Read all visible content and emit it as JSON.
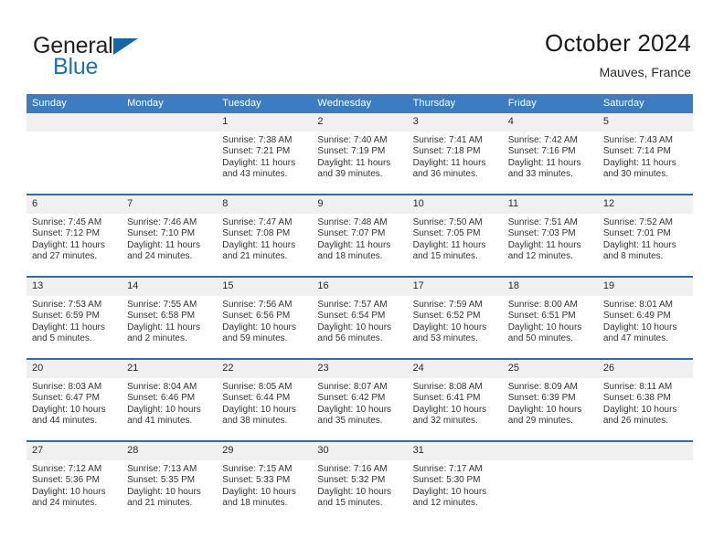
{
  "brand": {
    "name_part1": "General",
    "name_part2": "Blue",
    "accent_color": "#1565a8"
  },
  "header": {
    "title": "October 2024",
    "location": "Mauves, France"
  },
  "calendar": {
    "header_bg": "#3b7dc0",
    "separator_color": "#2e6da8",
    "daynum_bg": "#f0f0f0",
    "weekday_headers": [
      "Sunday",
      "Monday",
      "Tuesday",
      "Wednesday",
      "Thursday",
      "Friday",
      "Saturday"
    ],
    "weeks": [
      [
        {
          "day": "",
          "sunrise": "",
          "sunset": "",
          "daylight": ""
        },
        {
          "day": "",
          "sunrise": "",
          "sunset": "",
          "daylight": ""
        },
        {
          "day": "1",
          "sunrise": "Sunrise: 7:38 AM",
          "sunset": "Sunset: 7:21 PM",
          "daylight": "Daylight: 11 hours and 43 minutes."
        },
        {
          "day": "2",
          "sunrise": "Sunrise: 7:40 AM",
          "sunset": "Sunset: 7:19 PM",
          "daylight": "Daylight: 11 hours and 39 minutes."
        },
        {
          "day": "3",
          "sunrise": "Sunrise: 7:41 AM",
          "sunset": "Sunset: 7:18 PM",
          "daylight": "Daylight: 11 hours and 36 minutes."
        },
        {
          "day": "4",
          "sunrise": "Sunrise: 7:42 AM",
          "sunset": "Sunset: 7:16 PM",
          "daylight": "Daylight: 11 hours and 33 minutes."
        },
        {
          "day": "5",
          "sunrise": "Sunrise: 7:43 AM",
          "sunset": "Sunset: 7:14 PM",
          "daylight": "Daylight: 11 hours and 30 minutes."
        }
      ],
      [
        {
          "day": "6",
          "sunrise": "Sunrise: 7:45 AM",
          "sunset": "Sunset: 7:12 PM",
          "daylight": "Daylight: 11 hours and 27 minutes."
        },
        {
          "day": "7",
          "sunrise": "Sunrise: 7:46 AM",
          "sunset": "Sunset: 7:10 PM",
          "daylight": "Daylight: 11 hours and 24 minutes."
        },
        {
          "day": "8",
          "sunrise": "Sunrise: 7:47 AM",
          "sunset": "Sunset: 7:08 PM",
          "daylight": "Daylight: 11 hours and 21 minutes."
        },
        {
          "day": "9",
          "sunrise": "Sunrise: 7:48 AM",
          "sunset": "Sunset: 7:07 PM",
          "daylight": "Daylight: 11 hours and 18 minutes."
        },
        {
          "day": "10",
          "sunrise": "Sunrise: 7:50 AM",
          "sunset": "Sunset: 7:05 PM",
          "daylight": "Daylight: 11 hours and 15 minutes."
        },
        {
          "day": "11",
          "sunrise": "Sunrise: 7:51 AM",
          "sunset": "Sunset: 7:03 PM",
          "daylight": "Daylight: 11 hours and 12 minutes."
        },
        {
          "day": "12",
          "sunrise": "Sunrise: 7:52 AM",
          "sunset": "Sunset: 7:01 PM",
          "daylight": "Daylight: 11 hours and 8 minutes."
        }
      ],
      [
        {
          "day": "13",
          "sunrise": "Sunrise: 7:53 AM",
          "sunset": "Sunset: 6:59 PM",
          "daylight": "Daylight: 11 hours and 5 minutes."
        },
        {
          "day": "14",
          "sunrise": "Sunrise: 7:55 AM",
          "sunset": "Sunset: 6:58 PM",
          "daylight": "Daylight: 11 hours and 2 minutes."
        },
        {
          "day": "15",
          "sunrise": "Sunrise: 7:56 AM",
          "sunset": "Sunset: 6:56 PM",
          "daylight": "Daylight: 10 hours and 59 minutes."
        },
        {
          "day": "16",
          "sunrise": "Sunrise: 7:57 AM",
          "sunset": "Sunset: 6:54 PM",
          "daylight": "Daylight: 10 hours and 56 minutes."
        },
        {
          "day": "17",
          "sunrise": "Sunrise: 7:59 AM",
          "sunset": "Sunset: 6:52 PM",
          "daylight": "Daylight: 10 hours and 53 minutes."
        },
        {
          "day": "18",
          "sunrise": "Sunrise: 8:00 AM",
          "sunset": "Sunset: 6:51 PM",
          "daylight": "Daylight: 10 hours and 50 minutes."
        },
        {
          "day": "19",
          "sunrise": "Sunrise: 8:01 AM",
          "sunset": "Sunset: 6:49 PM",
          "daylight": "Daylight: 10 hours and 47 minutes."
        }
      ],
      [
        {
          "day": "20",
          "sunrise": "Sunrise: 8:03 AM",
          "sunset": "Sunset: 6:47 PM",
          "daylight": "Daylight: 10 hours and 44 minutes."
        },
        {
          "day": "21",
          "sunrise": "Sunrise: 8:04 AM",
          "sunset": "Sunset: 6:46 PM",
          "daylight": "Daylight: 10 hours and 41 minutes."
        },
        {
          "day": "22",
          "sunrise": "Sunrise: 8:05 AM",
          "sunset": "Sunset: 6:44 PM",
          "daylight": "Daylight: 10 hours and 38 minutes."
        },
        {
          "day": "23",
          "sunrise": "Sunrise: 8:07 AM",
          "sunset": "Sunset: 6:42 PM",
          "daylight": "Daylight: 10 hours and 35 minutes."
        },
        {
          "day": "24",
          "sunrise": "Sunrise: 8:08 AM",
          "sunset": "Sunset: 6:41 PM",
          "daylight": "Daylight: 10 hours and 32 minutes."
        },
        {
          "day": "25",
          "sunrise": "Sunrise: 8:09 AM",
          "sunset": "Sunset: 6:39 PM",
          "daylight": "Daylight: 10 hours and 29 minutes."
        },
        {
          "day": "26",
          "sunrise": "Sunrise: 8:11 AM",
          "sunset": "Sunset: 6:38 PM",
          "daylight": "Daylight: 10 hours and 26 minutes."
        }
      ],
      [
        {
          "day": "27",
          "sunrise": "Sunrise: 7:12 AM",
          "sunset": "Sunset: 5:36 PM",
          "daylight": "Daylight: 10 hours and 24 minutes."
        },
        {
          "day": "28",
          "sunrise": "Sunrise: 7:13 AM",
          "sunset": "Sunset: 5:35 PM",
          "daylight": "Daylight: 10 hours and 21 minutes."
        },
        {
          "day": "29",
          "sunrise": "Sunrise: 7:15 AM",
          "sunset": "Sunset: 5:33 PM",
          "daylight": "Daylight: 10 hours and 18 minutes."
        },
        {
          "day": "30",
          "sunrise": "Sunrise: 7:16 AM",
          "sunset": "Sunset: 5:32 PM",
          "daylight": "Daylight: 10 hours and 15 minutes."
        },
        {
          "day": "31",
          "sunrise": "Sunrise: 7:17 AM",
          "sunset": "Sunset: 5:30 PM",
          "daylight": "Daylight: 10 hours and 12 minutes."
        },
        {
          "day": "",
          "sunrise": "",
          "sunset": "",
          "daylight": ""
        },
        {
          "day": "",
          "sunrise": "",
          "sunset": "",
          "daylight": ""
        }
      ]
    ]
  }
}
